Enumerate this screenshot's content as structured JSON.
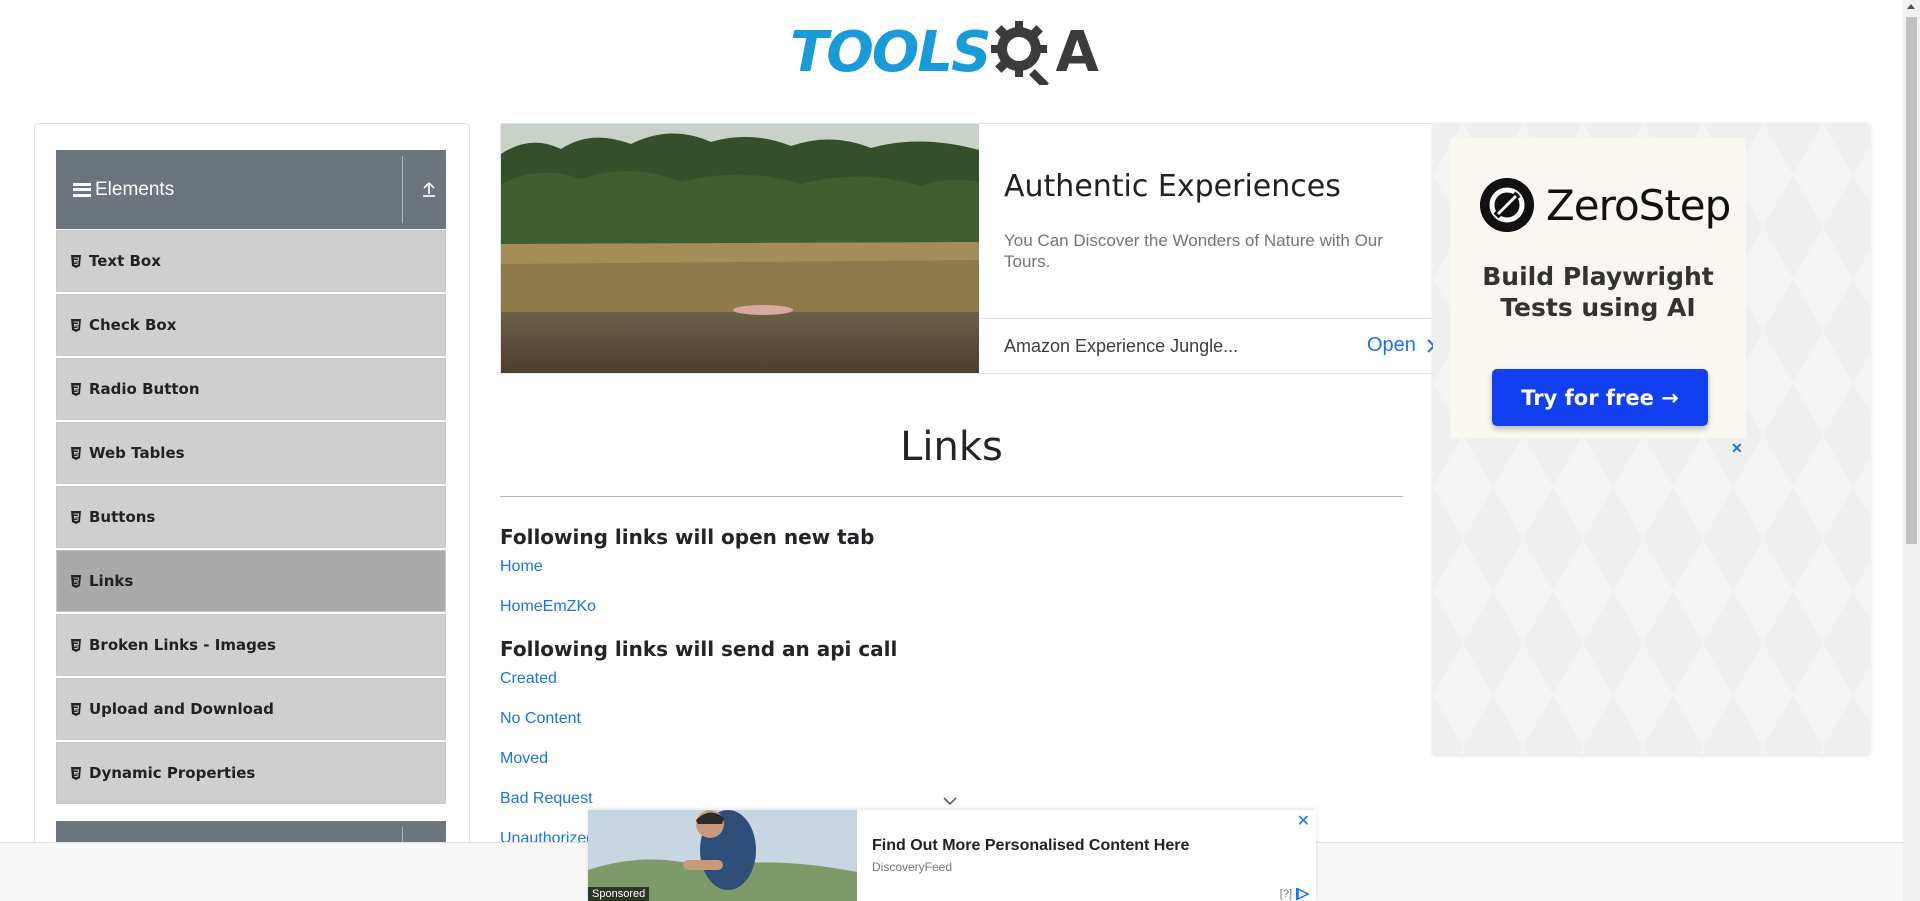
{
  "header": {
    "logo_text_tools": "TOOLS",
    "logo_text_qa": "A"
  },
  "sidebar": {
    "group_title": "Elements",
    "items": [
      {
        "label": "Text Box",
        "active": false
      },
      {
        "label": "Check Box",
        "active": false
      },
      {
        "label": "Radio Button",
        "active": false
      },
      {
        "label": "Web Tables",
        "active": false
      },
      {
        "label": "Buttons",
        "active": false
      },
      {
        "label": "Links",
        "active": true
      },
      {
        "label": "Broken Links - Images",
        "active": false
      },
      {
        "label": "Upload and Download",
        "active": false
      },
      {
        "label": "Dynamic Properties",
        "active": false
      }
    ]
  },
  "top_ad": {
    "title": "Authentic Experiences",
    "description": "You Can Discover the Wonders of Nature with Our Tours.",
    "source": "Amazon Experience Jungle...",
    "cta": "Open"
  },
  "main": {
    "page_title": "Links",
    "section_new_tab": "Following links will open new tab",
    "new_tab_links": [
      "Home",
      "HomeEmZKo"
    ],
    "section_api": "Following links will send an api call",
    "api_links": [
      "Created",
      "No Content",
      "Moved",
      "Bad Request",
      "Unauthorized"
    ]
  },
  "right_ad": {
    "brand": "ZeroStep",
    "tagline_line1": "Build Playwright",
    "tagline_line2": "Tests using AI",
    "button": "Try for free →",
    "close": "✕"
  },
  "bottom_ad": {
    "title": "Find Out More Personalised Content Here",
    "source": "DiscoveryFeed",
    "sponsored": "Sponsored",
    "close": "✕",
    "info": "[?]"
  },
  "colors": {
    "brand_blue": "#1a9bd7",
    "link_blue": "#1a73e8",
    "sidebar_header": "#6c757d",
    "zerostep_button": "#1240f0"
  }
}
